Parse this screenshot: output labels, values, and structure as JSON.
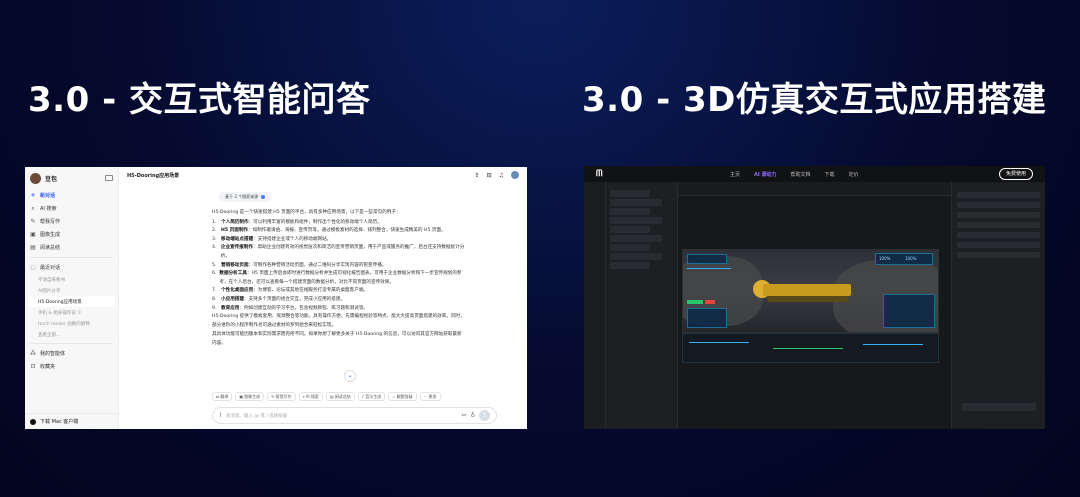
{
  "titles": {
    "left": "3.0 - 交互式智能问答",
    "right": "3.0 - 3D仿真交互式应用搭建"
  },
  "chat_app": {
    "brand": "豆包",
    "sidebar": {
      "new_chat": "新对话",
      "items": [
        "AI 搜索",
        "帮我写作",
        "图像生成",
        "阅读总结"
      ],
      "recent_header": "最近对话",
      "recent": [
        "不请自来看书",
        "AI图片分享",
        "H5-Dooring应用场景",
        "手机 & 相关操作说 ①",
        "torch render 函数的解释",
        "查看全部..."
      ],
      "my_agents": "我的智能体",
      "favorites": "收藏夹",
      "download": "下载 Mac 客户端"
    },
    "topbar_title": "H5-Dooring应用场景",
    "source_pill": "基于 3 个搜索来源",
    "intro": "H5-Dooring 是一个快速搭建 H5 页面的平台，具有多种应用场景，以下是一些常见的例子：",
    "list": [
      {
        "n": "1.",
        "title": "个人简历制作",
        "text": "：可以利用丰富的模板和组件，制作出个性化的移动端个人简历。"
      },
      {
        "n": "2.",
        "title": "H5 页面制作",
        "text": "：如制作邀请函、海报、宣传页等，通过模板素材的选择、排列整合，快速生成精美的 H5 页面。"
      },
      {
        "n": "3.",
        "title": "移动端站点搭建",
        "text": "：支持搭建企业或个人的移动端网站。"
      },
      {
        "n": "4.",
        "title": "企业宣传报制作",
        "text": "：帮助企业创建有效的视觉层次和简洁的宣传营销页面，用于产品或服务的推广，后台还支持数据统计分析。"
      },
      {
        "n": "5.",
        "title": "营销移动页面",
        "text": "：可制作各种营销活动页面，通过二维码分享实现内容的裂变传播。"
      },
      {
        "n": "6.",
        "title": "数据分析工具",
        "text": "：H5 页面上传后会即时进行数据分析并生成可视化报告图表，可用于企业数据分析和下一步宣传规划的参考，在个人后台，还可以查看每一个搭建页面的数据分析，对比不同页面的宣传效果。"
      },
      {
        "n": "7.",
        "title": "个性化桌面应用",
        "text": "：为博客、论坛或其他在线服务打造专属的桌面客户端。"
      },
      {
        "n": "8.",
        "title": "小应用搭建",
        "text": "：支持多个页面的组合交互，完成小应用的搭建。"
      },
      {
        "n": "9.",
        "title": "教育应用",
        "text": "：例如创建互动的学习平台，包含视频教程、练习题和测试等。"
      }
    ],
    "para2": "H5-Dooring 提供了模板套用、资源整合等功能，具有操作方便、先需编程经验等特点，能大大提高页面搭建的效率。同时，部分进阶的小程序制作也可通过素材的罗列组合来轻松实现。",
    "para3": "其具体功能可能因版本和实际需求而有所不同。如果你想了解更多关于 H5-Dooring 的信息，可以访问其官方网站获取最新内容。",
    "scroll_icon": "chevron-down",
    "chips": [
      "翻译",
      "图像生成",
      "帮我写作",
      "AI 搜索",
      "阅读总结",
      "音乐生成",
      "解题答疑",
      "更多"
    ],
    "input_placeholder": "发消息、输入 @ 或 / 选择技能"
  },
  "editor_app": {
    "nav_links": [
      "主页",
      "AI 源动力",
      "帮助文档",
      "下载",
      "定价"
    ],
    "cta": "免费使用",
    "accent_color": "#8f6bff",
    "hud_values": [
      "100%",
      "100%"
    ]
  }
}
